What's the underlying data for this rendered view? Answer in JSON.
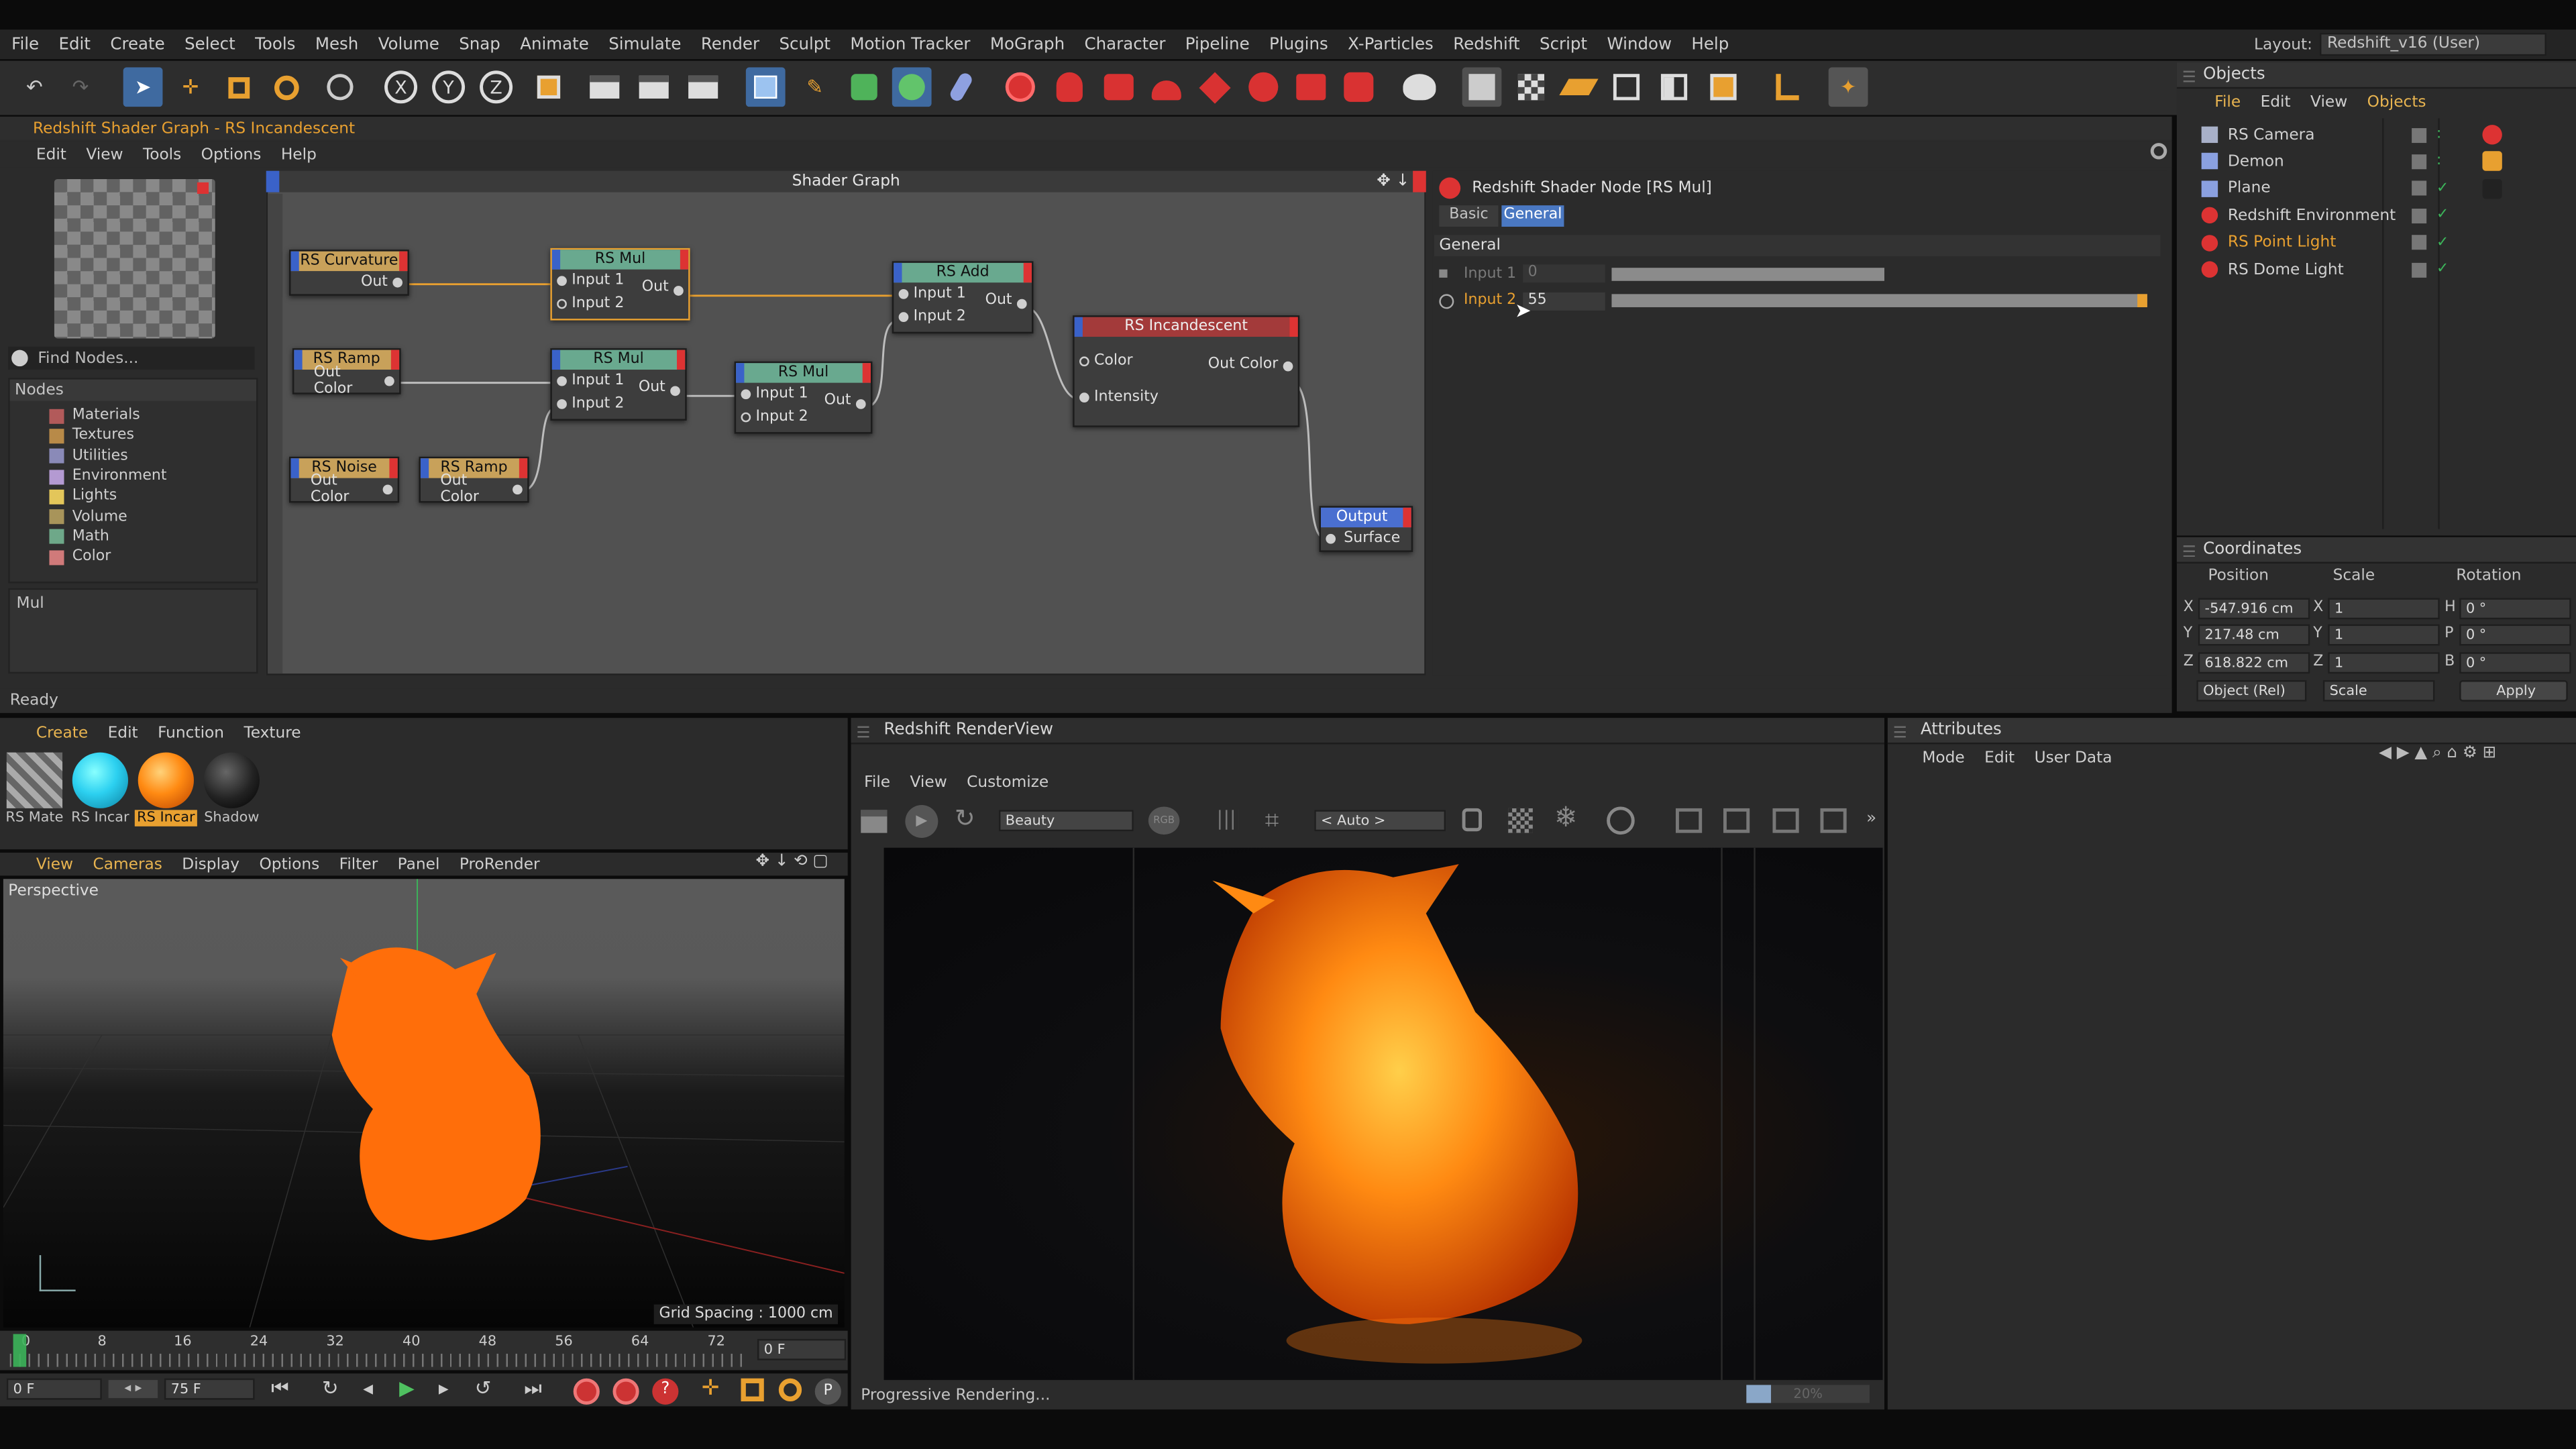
{
  "main_menu": [
    "File",
    "Edit",
    "Create",
    "Select",
    "Tools",
    "Mesh",
    "Volume",
    "Snap",
    "Animate",
    "Simulate",
    "Render",
    "Sculpt",
    "Motion Tracker",
    "MoGraph",
    "Character",
    "Pipeline",
    "Plugins",
    "X-Particles",
    "Redshift",
    "Script",
    "Window",
    "Help"
  ],
  "layout": {
    "label": "Layout:",
    "value": "Redshift_v16 (User)"
  },
  "shader_window": {
    "title": "Redshift Shader Graph - RS Incandescent",
    "menu": [
      "Edit",
      "View",
      "Tools",
      "Options",
      "Help"
    ],
    "graph_title": "Shader Graph",
    "find_placeholder": "Find Nodes...",
    "nodes_header": "Nodes",
    "categories": [
      {
        "label": "Materials",
        "color": "#b25a5a"
      },
      {
        "label": "Textures",
        "color": "#b88a48"
      },
      {
        "label": "Utilities",
        "color": "#8a8ab8"
      },
      {
        "label": "Environment",
        "color": "#b49ad2"
      },
      {
        "label": "Lights",
        "color": "#e3c65a"
      },
      {
        "label": "Volume",
        "color": "#a8945a"
      },
      {
        "label": "Math",
        "color": "#6ea889"
      },
      {
        "label": "Color",
        "color": "#d07a7a"
      }
    ],
    "selected_desc": "Mul",
    "status": "Ready"
  },
  "graph_nodes": {
    "curvature": {
      "title": "RS Curvature",
      "ports": [
        "Out"
      ]
    },
    "ramp1": {
      "title": "RS Ramp",
      "ports": [
        "Out Color"
      ]
    },
    "noise": {
      "title": "RS Noise",
      "ports": [
        "Out Color"
      ]
    },
    "ramp2": {
      "title": "RS Ramp",
      "ports": [
        "Out Color"
      ]
    },
    "mul1": {
      "title": "RS Mul",
      "in1": "Input 1",
      "in2": "Input 2",
      "out": "Out"
    },
    "mul2": {
      "title": "RS Mul",
      "in1": "Input 1",
      "in2": "Input 2",
      "out": "Out"
    },
    "mul3": {
      "title": "RS Mul",
      "in1": "Input 1",
      "in2": "Input 2",
      "out": "Out"
    },
    "add": {
      "title": "RS Add",
      "in1": "Input 1",
      "in2": "Input 2",
      "out": "Out"
    },
    "incand": {
      "title": "RS Incandescent",
      "in1": "Color",
      "in2": "Intensity",
      "out": "Out Color"
    },
    "output": {
      "title": "Output",
      "port": "Surface"
    }
  },
  "node_props": {
    "title": "Redshift Shader Node [RS Mul]",
    "tabs": [
      "Basic",
      "General"
    ],
    "section": "General",
    "input1": {
      "label": "Input 1",
      "value": "0"
    },
    "input2": {
      "label": "Input 2",
      "value": "55"
    }
  },
  "objects": {
    "title": "Objects",
    "menu": [
      "File",
      "Edit",
      "View",
      "Objects"
    ],
    "items": [
      "RS Camera",
      "Demon",
      "Plane",
      "Redshift Environment",
      "RS Point Light",
      "RS Dome Light"
    ]
  },
  "coordinates": {
    "title": "Coordinates",
    "headers": [
      "Position",
      "Scale",
      "Rotation"
    ],
    "rows": [
      {
        "axis": "X",
        "pos": "-547.916 cm",
        "saxis": "X",
        "scale": "1",
        "raxis": "H",
        "rot": "0 °"
      },
      {
        "axis": "Y",
        "pos": "217.48 cm",
        "saxis": "Y",
        "scale": "1",
        "raxis": "P",
        "rot": "0 °"
      },
      {
        "axis": "Z",
        "pos": "618.822 cm",
        "saxis": "Z",
        "scale": "1",
        "raxis": "B",
        "rot": "0 °"
      }
    ],
    "mode": "Object (Rel)",
    "scale_mode": "Scale",
    "apply": "Apply"
  },
  "material_manager": {
    "menu": [
      "Create",
      "Edit",
      "Function",
      "Texture"
    ],
    "materials": [
      {
        "label": "RS Mate"
      },
      {
        "label": "RS Incar"
      },
      {
        "label": "RS Incar"
      },
      {
        "label": "Shadow"
      }
    ]
  },
  "viewport": {
    "menu": [
      "View",
      "Cameras",
      "Display",
      "Options",
      "Filter",
      "Panel",
      "ProRender"
    ],
    "label": "Perspective",
    "grid": "Grid Spacing : 1000 cm"
  },
  "timeline": {
    "ticks": [
      "0",
      "8",
      "16",
      "24",
      "32",
      "40",
      "48",
      "56",
      "64",
      "72"
    ],
    "frame_right": "0 F",
    "start": "0 F",
    "end": "75 F"
  },
  "renderview": {
    "title": "Redshift RenderView",
    "menu": [
      "File",
      "View",
      "Customize"
    ],
    "aov": "Beauty",
    "rgb": "RGB",
    "auto": "< Auto >",
    "status": "Progressive Rendering...",
    "progress_label": "20%",
    "progress": 0.2
  },
  "attributes": {
    "title": "Attributes",
    "menu": [
      "Mode",
      "Edit",
      "User Data"
    ]
  }
}
